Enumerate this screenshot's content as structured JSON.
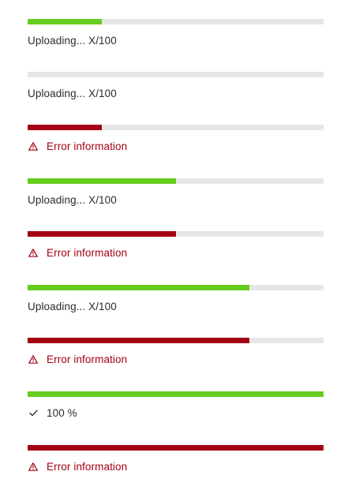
{
  "colors": {
    "success": "#66cc1d",
    "error": "#a30014",
    "track": "#e6e6e6",
    "text": "#2b2b2b"
  },
  "progress_items": [
    {
      "variant": "success",
      "progress": 0.25,
      "status_text": "Uploading... X/100",
      "icon": null
    },
    {
      "variant": "success",
      "progress": 0.0,
      "status_text": "Uploading... X/100",
      "icon": null
    },
    {
      "variant": "error",
      "progress": 0.25,
      "status_text": "Error information",
      "icon": "warning-icon"
    },
    {
      "variant": "success",
      "progress": 0.5,
      "status_text": "Uploading... X/100",
      "icon": null
    },
    {
      "variant": "error",
      "progress": 0.5,
      "status_text": "Error information",
      "icon": "warning-icon"
    },
    {
      "variant": "success",
      "progress": 0.75,
      "status_text": "Uploading... X/100",
      "icon": null
    },
    {
      "variant": "error",
      "progress": 0.75,
      "status_text": "Error information",
      "icon": "warning-icon"
    },
    {
      "variant": "success",
      "progress": 1.0,
      "status_text": "100 %",
      "icon": "checkmark-icon"
    },
    {
      "variant": "error",
      "progress": 1.0,
      "status_text": "Error information",
      "icon": "warning-icon"
    }
  ]
}
